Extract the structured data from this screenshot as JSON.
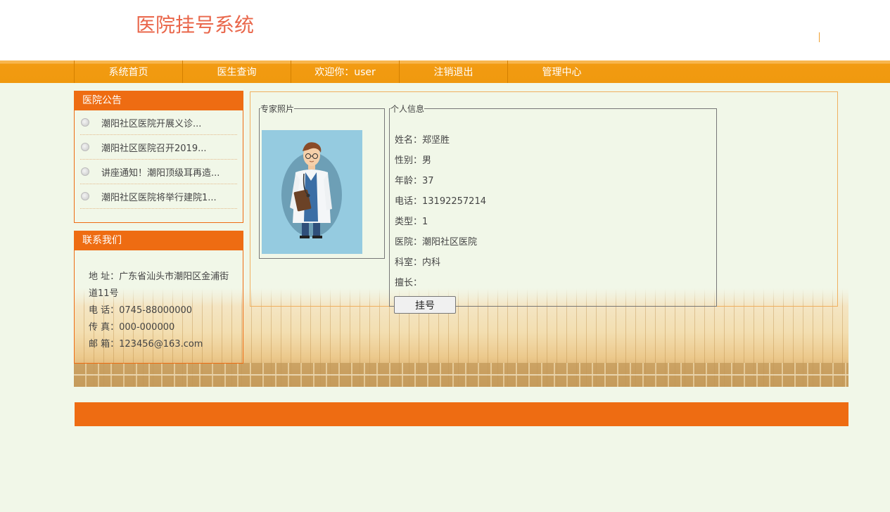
{
  "header": {
    "title": "医院挂号系统"
  },
  "nav": {
    "items": [
      "系统首页",
      "医生查询",
      "欢迎你：user",
      "注销退出",
      "管理中心"
    ]
  },
  "notice": {
    "title": "医院公告",
    "items": [
      "潮阳社区医院开展义诊...",
      "潮阳社区医院召开2019...",
      "讲座通知！潮阳顶级耳再造...",
      "潮阳社区医院将举行建院1..."
    ]
  },
  "contact": {
    "title": "联系我们",
    "address": "地 址：广东省汕头市潮阳区金浦街道11号",
    "phone": "电 话：0745-88000000",
    "fax": "传 真：000-000000",
    "email": "邮 箱：123456@163.com"
  },
  "doctor": {
    "photo_legend": "专家照片",
    "info_legend": "个人信息",
    "name": "姓名：郑坚胜",
    "gender": "性别：男",
    "age": "年龄：37",
    "phone": "电话：13192257214",
    "type": "类型：1",
    "hospital": "医院：潮阳社区医院",
    "department": "科室：内科",
    "specialty": "擅长：",
    "register_button": "挂号"
  },
  "colors": {
    "accent": "#ee6c12",
    "nav": "#f0990e",
    "title": "#e9664a",
    "background": "#f1f7e8"
  }
}
